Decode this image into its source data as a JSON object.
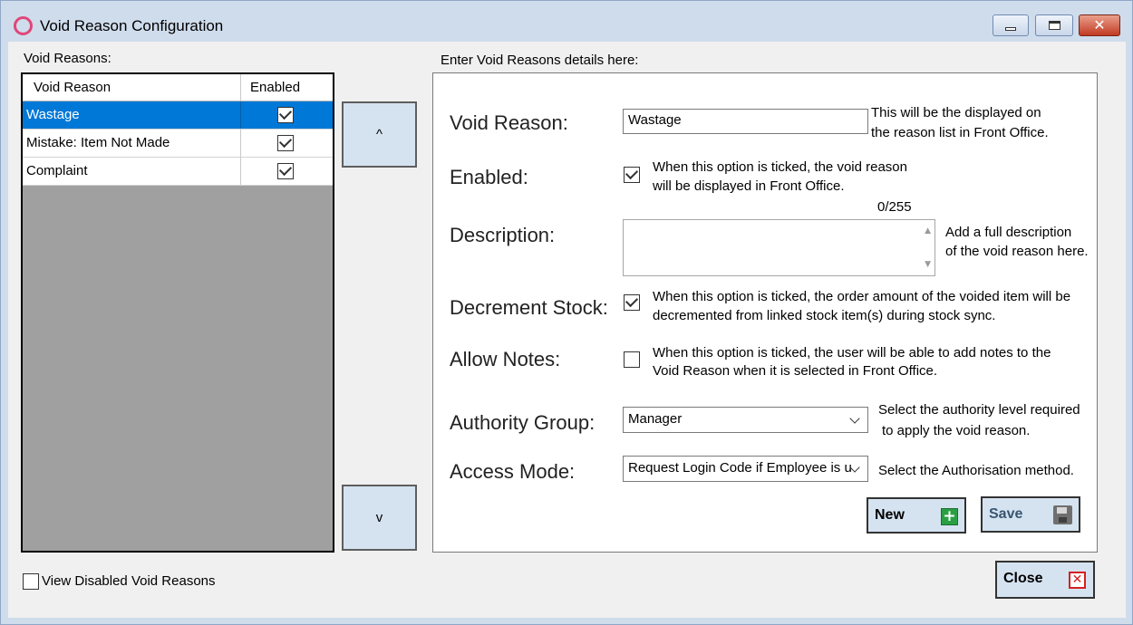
{
  "window": {
    "title": "Void Reason Configuration"
  },
  "list": {
    "section_label": "Void Reasons:",
    "columns": {
      "name": "Void Reason",
      "enabled": "Enabled"
    },
    "rows": [
      {
        "name": "Wastage",
        "enabled": true,
        "selected": true
      },
      {
        "name": "Mistake: Item Not Made",
        "enabled": true,
        "selected": false
      },
      {
        "name": "Complaint",
        "enabled": true,
        "selected": false
      }
    ],
    "move_up_label": "^",
    "move_down_label": "v",
    "view_disabled_label": "View Disabled Void Reasons",
    "view_disabled_checked": false
  },
  "details": {
    "section_label": "Enter Void Reasons details here:",
    "void_reason": {
      "label": "Void Reason:",
      "value": "Wastage",
      "help_line1": "This will be the displayed on",
      "help_line2": "the reason list in Front Office."
    },
    "enabled": {
      "label": "Enabled:",
      "checked": true,
      "help_line1": "When this option is ticked, the void reason",
      "help_line2": "will be displayed in Front Office."
    },
    "description": {
      "label": "Description:",
      "value": "",
      "counter": "0/255",
      "help_line1": "Add a full description",
      "help_line2": "of the void reason here."
    },
    "decrement_stock": {
      "label": "Decrement Stock:",
      "checked": true,
      "help_line1": "When this option is ticked, the order amount of the voided item will be",
      "help_line2": "decremented from linked stock item(s) during stock sync."
    },
    "allow_notes": {
      "label": "Allow Notes:",
      "checked": false,
      "help_line1": "When this option is ticked, the user will be able to add notes to the",
      "help_line2": "Void Reason when it is selected in Front Office."
    },
    "authority_group": {
      "label": "Authority Group:",
      "value": "Manager",
      "help_line1": "Select the authority level required",
      "help_line2": "to apply the void reason."
    },
    "access_mode": {
      "label": "Access Mode:",
      "value": "Request Login Code if Employee is u",
      "help": "Select the Authorisation method."
    },
    "new_label": "New",
    "save_label": "Save"
  },
  "footer": {
    "close_label": "Close"
  },
  "icons": {
    "app": "ring-icon",
    "new": "plus-icon",
    "save": "floppy-disk-icon",
    "close": "x-icon"
  },
  "colors": {
    "selection": "#0078d7",
    "button_face": "#d5e3f1",
    "app_icon": "#e0467a",
    "new_icon": "#2aa043",
    "close_icon": "#d62020"
  }
}
